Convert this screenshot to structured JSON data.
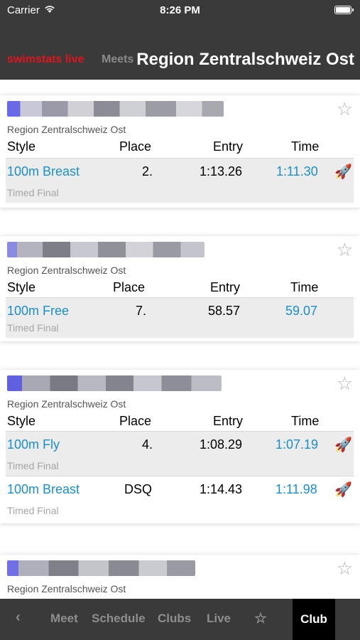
{
  "status": {
    "carrier": "Carrier",
    "time": "8:26 PM"
  },
  "nav": {
    "brand": "swimstats live",
    "meets": "Meets",
    "title": "Region Zentralschweiz Ost"
  },
  "table_headers": {
    "style": "Style",
    "place": "Place",
    "entry": "Entry",
    "time": "Time"
  },
  "cards": [
    {
      "region": "Region Zentralschweiz Ost",
      "results": [
        {
          "style": "100m Breast",
          "place": "2.",
          "entry": "1:13.26",
          "time": "1:11.30",
          "round": "Timed Final",
          "rocket": true
        }
      ]
    },
    {
      "region": "Region Zentralschweiz Ost",
      "results": [
        {
          "style": "100m Free",
          "place": "7.",
          "entry": "58.57",
          "time": "59.07",
          "round": "Timed Final",
          "rocket": false
        }
      ]
    },
    {
      "region": "Region Zentralschweiz Ost",
      "results": [
        {
          "style": "100m Fly",
          "place": "4.",
          "entry": "1:08.29",
          "time": "1:07.19",
          "round": "Timed Final",
          "rocket": true
        },
        {
          "style": "100m Breast",
          "place": "DSQ",
          "entry": "1:14.43",
          "time": "1:11.98",
          "round": "Timed Final",
          "rocket": true
        }
      ]
    },
    {
      "region": "Region Zentralschweiz Ost",
      "results": []
    }
  ],
  "tabbar": {
    "back": "‹",
    "meet": "Meet",
    "schedule": "Schedule",
    "clubs": "Clubs",
    "live": "Live",
    "star": "☆",
    "club": "Club"
  },
  "colors": {
    "brand_red": "#e0141c",
    "link_blue": "#1a8fc8",
    "bar_bg": "#3a3a3a"
  }
}
